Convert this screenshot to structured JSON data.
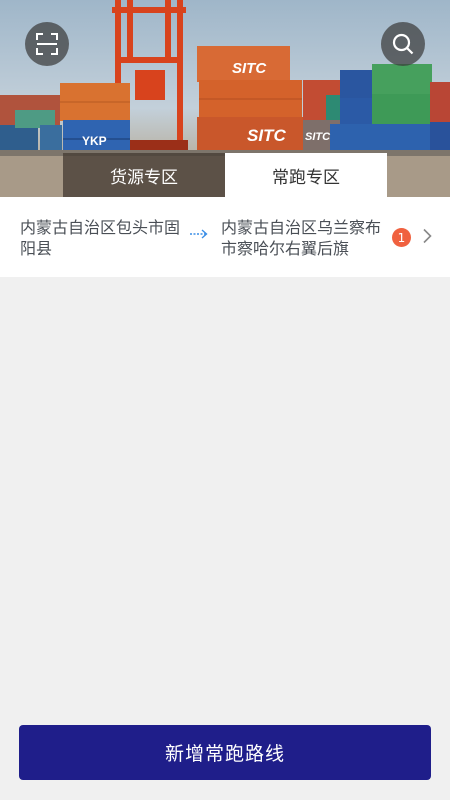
{
  "header": {
    "scan_icon": "scan-icon",
    "search_icon": "search-icon",
    "banner_container_labels": [
      "SITC",
      "SITC",
      "SITC",
      "YKP"
    ]
  },
  "tabs": [
    {
      "label": "货源专区",
      "active": false
    },
    {
      "label": "常跑专区",
      "active": true
    }
  ],
  "route": {
    "from": "内蒙古自治区包头市固阳县",
    "to": "内蒙古自治区乌兰察布市察哈尔右翼后旗",
    "count": "1",
    "arrow_icon": "arrow-right-icon",
    "chevron_icon": "chevron-right-icon"
  },
  "footer": {
    "add_button_label": "新增常跑路线"
  },
  "colors": {
    "primary_button": "#1f1e8a",
    "badge": "#f0613f",
    "arrow": "#3a8ee6",
    "page_background": "#f0f0f0"
  }
}
